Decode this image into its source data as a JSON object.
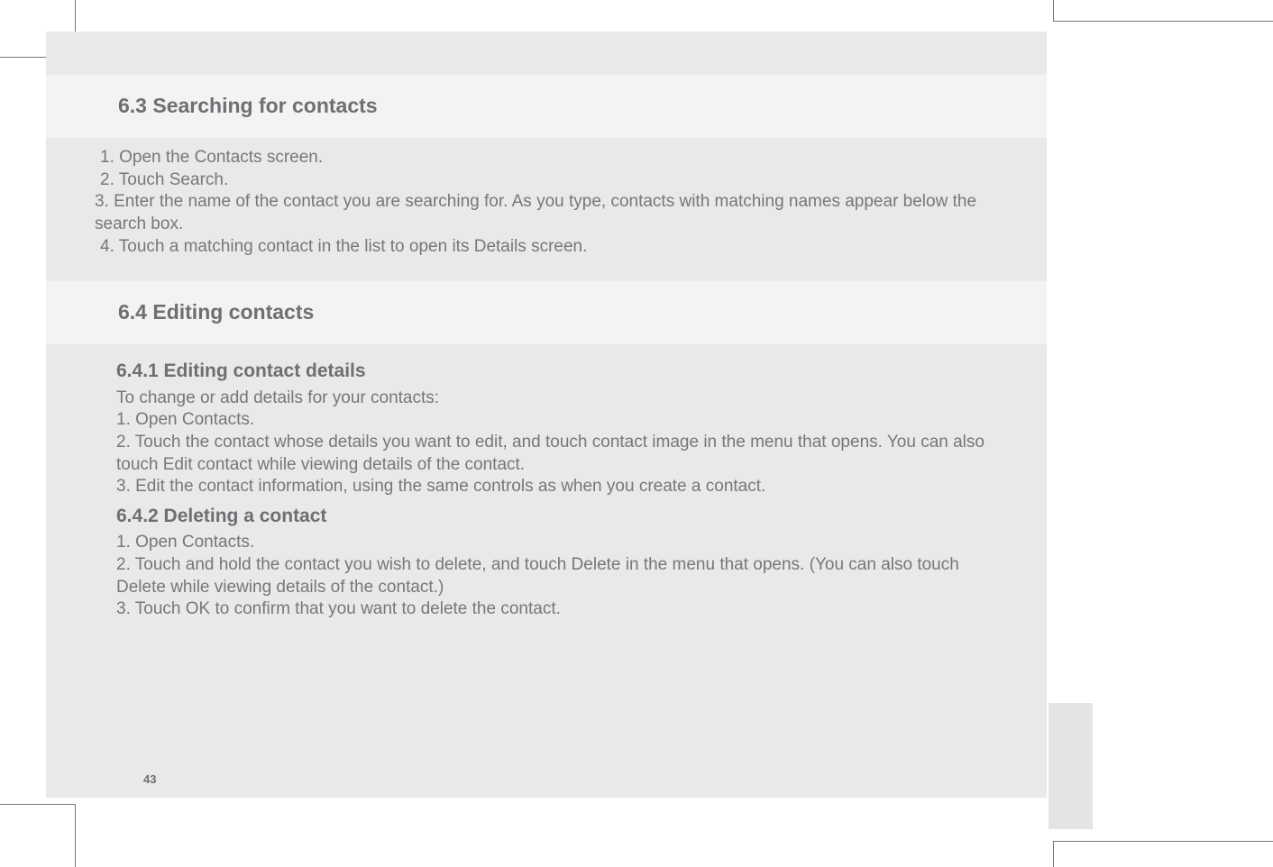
{
  "sections": {
    "s1": {
      "heading": "6.3 Searching for contacts",
      "steps": {
        "l1": " 1. Open the Contacts screen.",
        "l2": " 2. Touch Search.",
        "l3": " 3. Enter the name of the contact you are searching for. As you type, contacts with matching names appear below the search box.",
        "l4": " 4. Touch a matching contact in the list to open its Details screen."
      }
    },
    "s2": {
      "heading": "6.4 Editing contacts",
      "sub1": {
        "title": "6.4.1 Editing contact details",
        "intro": "To change or add details for your contacts:",
        "l1": " 1. Open Contacts.",
        "l2": "2. Touch the contact whose details you want to edit, and touch contact image in the menu that opens. You can also touch Edit contact while viewing details of the contact.",
        "l3": " 3. Edit the contact information, using the same controls as when you create a contact."
      },
      "sub2": {
        "title": "6.4.2 Deleting a contact",
        "l1": " 1. Open Contacts.",
        "l2": "2. Touch and hold the contact you wish to delete, and touch Delete in the menu that opens. (You can also touch Delete while viewing details of the contact.)",
        "l3": "3. Touch OK to confirm that you want to delete the contact."
      }
    }
  },
  "page_number": "43"
}
